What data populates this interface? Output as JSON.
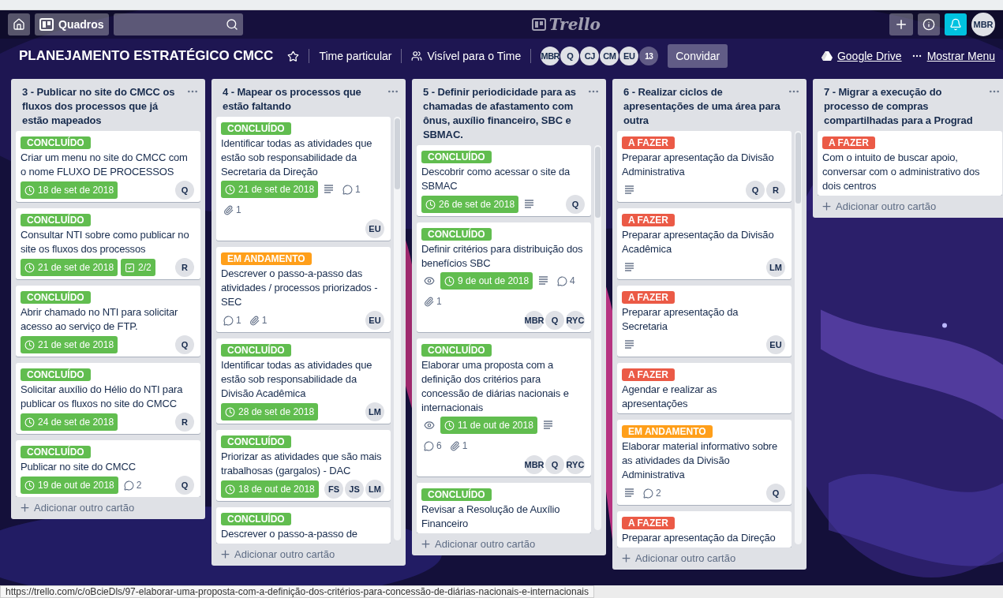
{
  "header": {
    "boards_button": "Quadros",
    "logo": "Trello",
    "avatar": "MBR"
  },
  "board_bar": {
    "title": "PLANEJAMENTO ESTRATÉGICO CMCC",
    "starred": false,
    "team": "Time particular",
    "visibility": "Visível para o Time",
    "members": [
      "MBR",
      "Q",
      "CJ",
      "CM",
      "EU"
    ],
    "member_count": "13",
    "invite": "Convidar",
    "drive": "Google Drive",
    "menu": "Mostrar Menu"
  },
  "lists": [
    {
      "title": "3 - Publicar no site do CMCC os fluxos dos processos que já estão mapeados",
      "scrollable": false,
      "add_card": "Adicionar outro cartão",
      "cards": [
        {
          "label": {
            "text": "CONCLUÍDO",
            "color": "#61bd4f"
          },
          "title": "Criar um menu no site do CMCC com o nome FLUXO DE PROCESSOS",
          "badges": [
            {
              "kind": "due",
              "text": "18 de set de 2018",
              "done": true
            }
          ],
          "members": [
            "Q"
          ]
        },
        {
          "label": {
            "text": "CONCLUÍDO",
            "color": "#61bd4f"
          },
          "title": "Consultar NTI sobre como publicar no site os fluxos dos processos",
          "badges": [
            {
              "kind": "due",
              "text": "21 de set de 2018",
              "done": true
            },
            {
              "kind": "checklist",
              "text": "2/2",
              "done": true
            }
          ],
          "members": [
            "R"
          ]
        },
        {
          "label": {
            "text": "CONCLUÍDO",
            "color": "#61bd4f"
          },
          "title": "Abrir chamado no NTI para solicitar acesso ao serviço de FTP.",
          "badges": [
            {
              "kind": "due",
              "text": "21 de set de 2018",
              "done": true
            }
          ],
          "members": [
            "Q"
          ]
        },
        {
          "label": {
            "text": "CONCLUÍDO",
            "color": "#61bd4f"
          },
          "title": "Solicitar auxílio do Hélio do NTI para publicar os fluxos no site do CMCC",
          "badges": [
            {
              "kind": "due",
              "text": "24 de set de 2018",
              "done": true
            }
          ],
          "members": [
            "R"
          ]
        },
        {
          "label": {
            "text": "CONCLUÍDO",
            "color": "#61bd4f"
          },
          "title": "Publicar no site do CMCC",
          "badges": [
            {
              "kind": "due",
              "text": "19 de out de 2018",
              "done": true
            },
            {
              "kind": "comments",
              "text": "2"
            }
          ],
          "members": [
            "Q"
          ]
        }
      ]
    },
    {
      "title": "4 - Mapear os processos que estão faltando",
      "scrollable": true,
      "add_card": "Adicionar outro cartão",
      "cards": [
        {
          "label": {
            "text": "CONCLUÍDO",
            "color": "#61bd4f"
          },
          "title": "Identificar todas as atividades que estão sob responsabilidade da Secretaria da Direção",
          "badges": [
            {
              "kind": "due",
              "text": "21 de set de 2018",
              "done": true
            },
            {
              "kind": "description"
            },
            {
              "kind": "comments",
              "text": "1"
            },
            {
              "kind": "attachments",
              "text": "1"
            }
          ],
          "members": [
            "EU"
          ]
        },
        {
          "label": {
            "text": "EM ANDAMENTO",
            "color": "#ff9f1a"
          },
          "title": "Descrever o passo-a-passo das atividades / processos priorizados - SEC",
          "badges": [
            {
              "kind": "comments",
              "text": "1"
            },
            {
              "kind": "attachments",
              "text": "1"
            }
          ],
          "members": [
            "EU"
          ]
        },
        {
          "label": {
            "text": "CONCLUÍDO",
            "color": "#61bd4f"
          },
          "title": "Identificar todas as atividades que estão sob responsabilidade da Divisão Acadêmica",
          "badges": [
            {
              "kind": "due",
              "text": "28 de set de 2018",
              "done": true
            }
          ],
          "members": [
            "LM"
          ]
        },
        {
          "label": {
            "text": "CONCLUÍDO",
            "color": "#61bd4f"
          },
          "title": "Priorizar as atividades que são mais trabalhosas (gargalos) - DAC",
          "badges": [
            {
              "kind": "due",
              "text": "18 de out de 2018",
              "done": true
            }
          ],
          "members": [
            "FS",
            "JS",
            "LM"
          ]
        },
        {
          "label": {
            "text": "CONCLUÍDO",
            "color": "#61bd4f"
          },
          "title": "Descrever o passo-a-passo de"
        }
      ]
    },
    {
      "title": "5 - Definir periodicidade para as chamadas de afastamento com ônus, auxílio financeiro, SBC e SBMAC.",
      "scrollable": true,
      "add_card": "Adicionar outro cartão",
      "cards": [
        {
          "label": {
            "text": "CONCLUÍDO",
            "color": "#61bd4f"
          },
          "title": "Descobrir como acessar o site da SBMAC",
          "badges": [
            {
              "kind": "due",
              "text": "26 de set de 2018",
              "done": true
            },
            {
              "kind": "description"
            }
          ],
          "members": [
            "Q"
          ]
        },
        {
          "label": {
            "text": "CONCLUÍDO",
            "color": "#61bd4f"
          },
          "title": "Definir critérios para distribuição dos benefícios SBC",
          "badges": [
            {
              "kind": "watching"
            },
            {
              "kind": "due",
              "text": "9 de out de 2018",
              "done": true
            },
            {
              "kind": "description"
            },
            {
              "kind": "comments",
              "text": "4"
            },
            {
              "kind": "attachments",
              "text": "1"
            }
          ],
          "members": [
            "MBR",
            "Q",
            "RYC"
          ]
        },
        {
          "label": {
            "text": "CONCLUÍDO",
            "color": "#61bd4f"
          },
          "title": "Elaborar uma proposta com a definição dos critérios para concessão de diárias nacionais e internacionais",
          "badges": [
            {
              "kind": "watching"
            },
            {
              "kind": "due",
              "text": "11 de out de 2018",
              "done": true
            },
            {
              "kind": "description"
            },
            {
              "kind": "comments",
              "text": "6"
            },
            {
              "kind": "attachments",
              "text": "1"
            }
          ],
          "members": [
            "MBR",
            "Q",
            "RYC"
          ]
        },
        {
          "label": {
            "text": "CONCLUÍDO",
            "color": "#61bd4f"
          },
          "title": "Revisar a Resolução de Auxílio Financeiro"
        }
      ]
    },
    {
      "title": "6 - Realizar ciclos de apresentações de uma área para outra",
      "scrollable": true,
      "add_card": "Adicionar outro cartão",
      "cards": [
        {
          "label": {
            "text": "A FAZER",
            "color": "#eb5a46"
          },
          "title": "Preparar apresentação da Divisão Administrativa",
          "badges": [
            {
              "kind": "description"
            }
          ],
          "members": [
            "Q",
            "R"
          ]
        },
        {
          "label": {
            "text": "A FAZER",
            "color": "#eb5a46"
          },
          "title": "Preparar apresentação da Divisão Acadêmica",
          "badges": [
            {
              "kind": "description"
            }
          ],
          "members": [
            "LM"
          ]
        },
        {
          "label": {
            "text": "A FAZER",
            "color": "#eb5a46"
          },
          "title": "Preparar apresentação da Secretaria",
          "badges": [
            {
              "kind": "description"
            }
          ],
          "members": [
            "EU"
          ]
        },
        {
          "label": {
            "text": "A FAZER",
            "color": "#eb5a46"
          },
          "title": "Agendar e realizar as apresentações"
        },
        {
          "label": {
            "text": "EM ANDAMENTO",
            "color": "#ff9f1a"
          },
          "title": "Elaborar material informativo sobre as atividades da Divisão Administrativa",
          "badges": [
            {
              "kind": "description"
            },
            {
              "kind": "comments",
              "text": "2"
            }
          ],
          "members": [
            "Q"
          ]
        },
        {
          "label": {
            "text": "A FAZER",
            "color": "#eb5a46"
          },
          "title": "Preparar apresentação da Direção"
        }
      ]
    },
    {
      "title": "7 - Migrar a execução do processo de compras compartilhadas para a Prograd",
      "scrollable": false,
      "add_card": "Adicionar outro cartão",
      "cards": [
        {
          "label": {
            "text": "A FAZER",
            "color": "#eb5a46"
          },
          "title": "Com o intuito de buscar apoio, conversar com o administrativo dos dois centros"
        }
      ]
    }
  ],
  "status_url": "https://trello.com/c/oBcieDls/97-elaborar-uma-proposta-com-a-definição-dos-critérios-para-concessão-de-diárias-nacionais-e-internacionais"
}
